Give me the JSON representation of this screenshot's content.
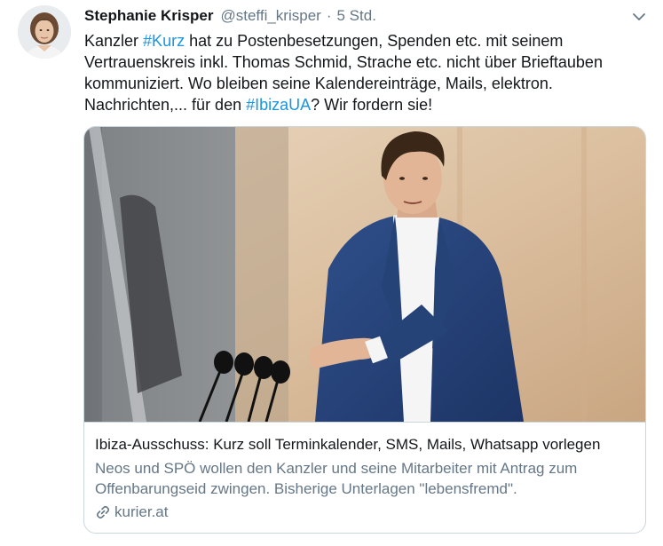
{
  "author": {
    "name": "Stephanie Krisper",
    "handle": "@steffi_krisper",
    "separator": "·",
    "time": "5 Std."
  },
  "tweet": {
    "seg1": "Kanzler ",
    "hashtag1": "#Kurz",
    "seg2": " hat zu Postenbesetzungen, Spenden etc. mit seinem Vertrauenskreis inkl. Thomas Schmid, Strache etc. nicht über Brieftauben kommuniziert. Wo bleiben seine Kalendereinträge, Mails, elektron. Nachrichten,... für den ",
    "hashtag2": "#IbizaUA",
    "seg3": "? Wir fordern sie!"
  },
  "card": {
    "title": "Ibiza-Ausschuss: Kurz soll Terminkalender, SMS, Mails, Whatsapp vorlegen",
    "description": "Neos und SPÖ wollen den Kanzler und seine Mitarbeiter mit Antrag zum Offenbarungseid zwingen. Bisherige Unterlagen \"lebensfremd\".",
    "domain": "kurier.at"
  },
  "icons": {
    "menu": "chevron-down-icon",
    "link": "link-icon"
  },
  "colors": {
    "link": "#1b95e0",
    "secondary_text": "#657786",
    "border": "#ccd6dd"
  }
}
